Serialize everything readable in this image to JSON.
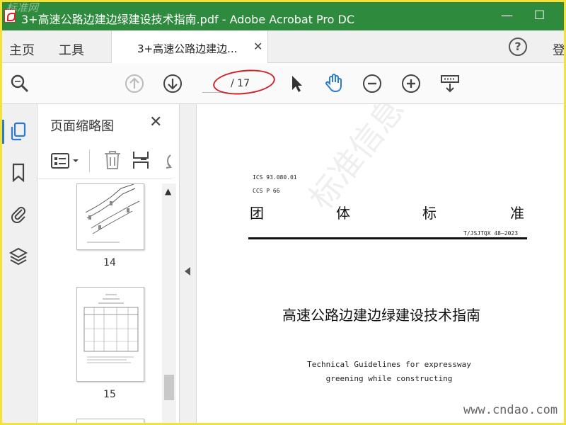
{
  "window": {
    "title": "3+高速公路边建边绿建设技术指南.pdf - Adobe Acrobat Pro DC",
    "minimize": "—",
    "maximize": "☐",
    "corner_watermark": "标准网"
  },
  "menu": {
    "home": "主页",
    "tools": "工具",
    "doc_tab": "3+高速公路边建边...",
    "tab_close": "✕",
    "help": "?",
    "signin": "登"
  },
  "toolbar": {
    "current_page": "",
    "total_pages": "/ 17"
  },
  "sidebar": {
    "title": "页面缩略图",
    "close": "✕",
    "thumbnails": [
      {
        "page": "14"
      },
      {
        "page": "15"
      }
    ]
  },
  "document": {
    "ics": "ICS 93.080.01",
    "ccs": "CCS P 66",
    "heading_chars": [
      "团",
      "体",
      "标",
      "准"
    ],
    "code": "T/JSJTQX 48—2023",
    "title_cn": "高速公路边建边绿建设技术指南",
    "title_en_line1": "Technical Guidelines for expressway",
    "title_en_line2": "greening while constructing",
    "watermark": "标准信息平台"
  },
  "overlay": {
    "site": "www.cndao.com"
  },
  "colors": {
    "titlebar": "#2e8b3e",
    "highlight_ellipse": "#d0222a",
    "active_tool": "#2b7bd1",
    "frame": "#f4e23a"
  }
}
